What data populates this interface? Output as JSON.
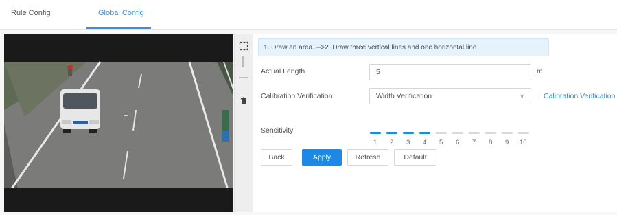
{
  "tabs": [
    {
      "label": "Rule Config"
    },
    {
      "label": "Global Config"
    }
  ],
  "toolbar": {
    "icons": [
      "draw-area-icon",
      "vertical-line-icon",
      "horizontal-line-icon",
      "clear-icon"
    ]
  },
  "form": {
    "tip": "1. Draw an area. -->2. Draw three vertical lines and one horizontal line.",
    "actual_length": {
      "label": "Actual Length",
      "value": "5",
      "unit": "m"
    },
    "calibration": {
      "label": "Calibration Verification",
      "selected": "Width Verification",
      "link": "Calibration Verification"
    },
    "sensitivity": {
      "label": "Sensitivity",
      "value": 5,
      "scale": [
        "1",
        "2",
        "3",
        "4",
        "5",
        "6",
        "7",
        "8",
        "9",
        "10"
      ]
    }
  },
  "buttons": {
    "back": "Back",
    "apply": "Apply",
    "refresh": "Refresh",
    "default": "Default"
  },
  "colors": {
    "accent": "#1e88e5",
    "accent_tab": "#3b8fd8",
    "sensitivity_active": "#1e88e5",
    "sensitivity_inactive": "#d9d9d9",
    "tip_bg": "#e6f3fd"
  }
}
